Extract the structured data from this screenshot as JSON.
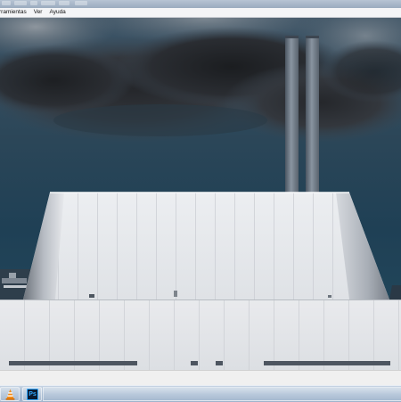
{
  "menubar": {
    "items": [
      "rramientas",
      "Ver",
      "Ayuda"
    ]
  },
  "viewer": {
    "image_subject": "white cone-shaped industrial plant building with twin smokestacks under a dark stormy sky"
  },
  "progress": {
    "fraction": 0.45
  },
  "taskbar": {
    "apps": [
      {
        "icon": "vlc-icon"
      },
      {
        "icon": "photoshop-icon",
        "text": "Ps"
      }
    ]
  },
  "colors": {
    "sky": "#244457",
    "cloud": "#2c3036",
    "building": "#e4e6ea",
    "progress": "#2d7fd0",
    "vlc": "#f28b17",
    "photoshop": "#0b1a30",
    "photoshop_text": "#31a8ff"
  }
}
